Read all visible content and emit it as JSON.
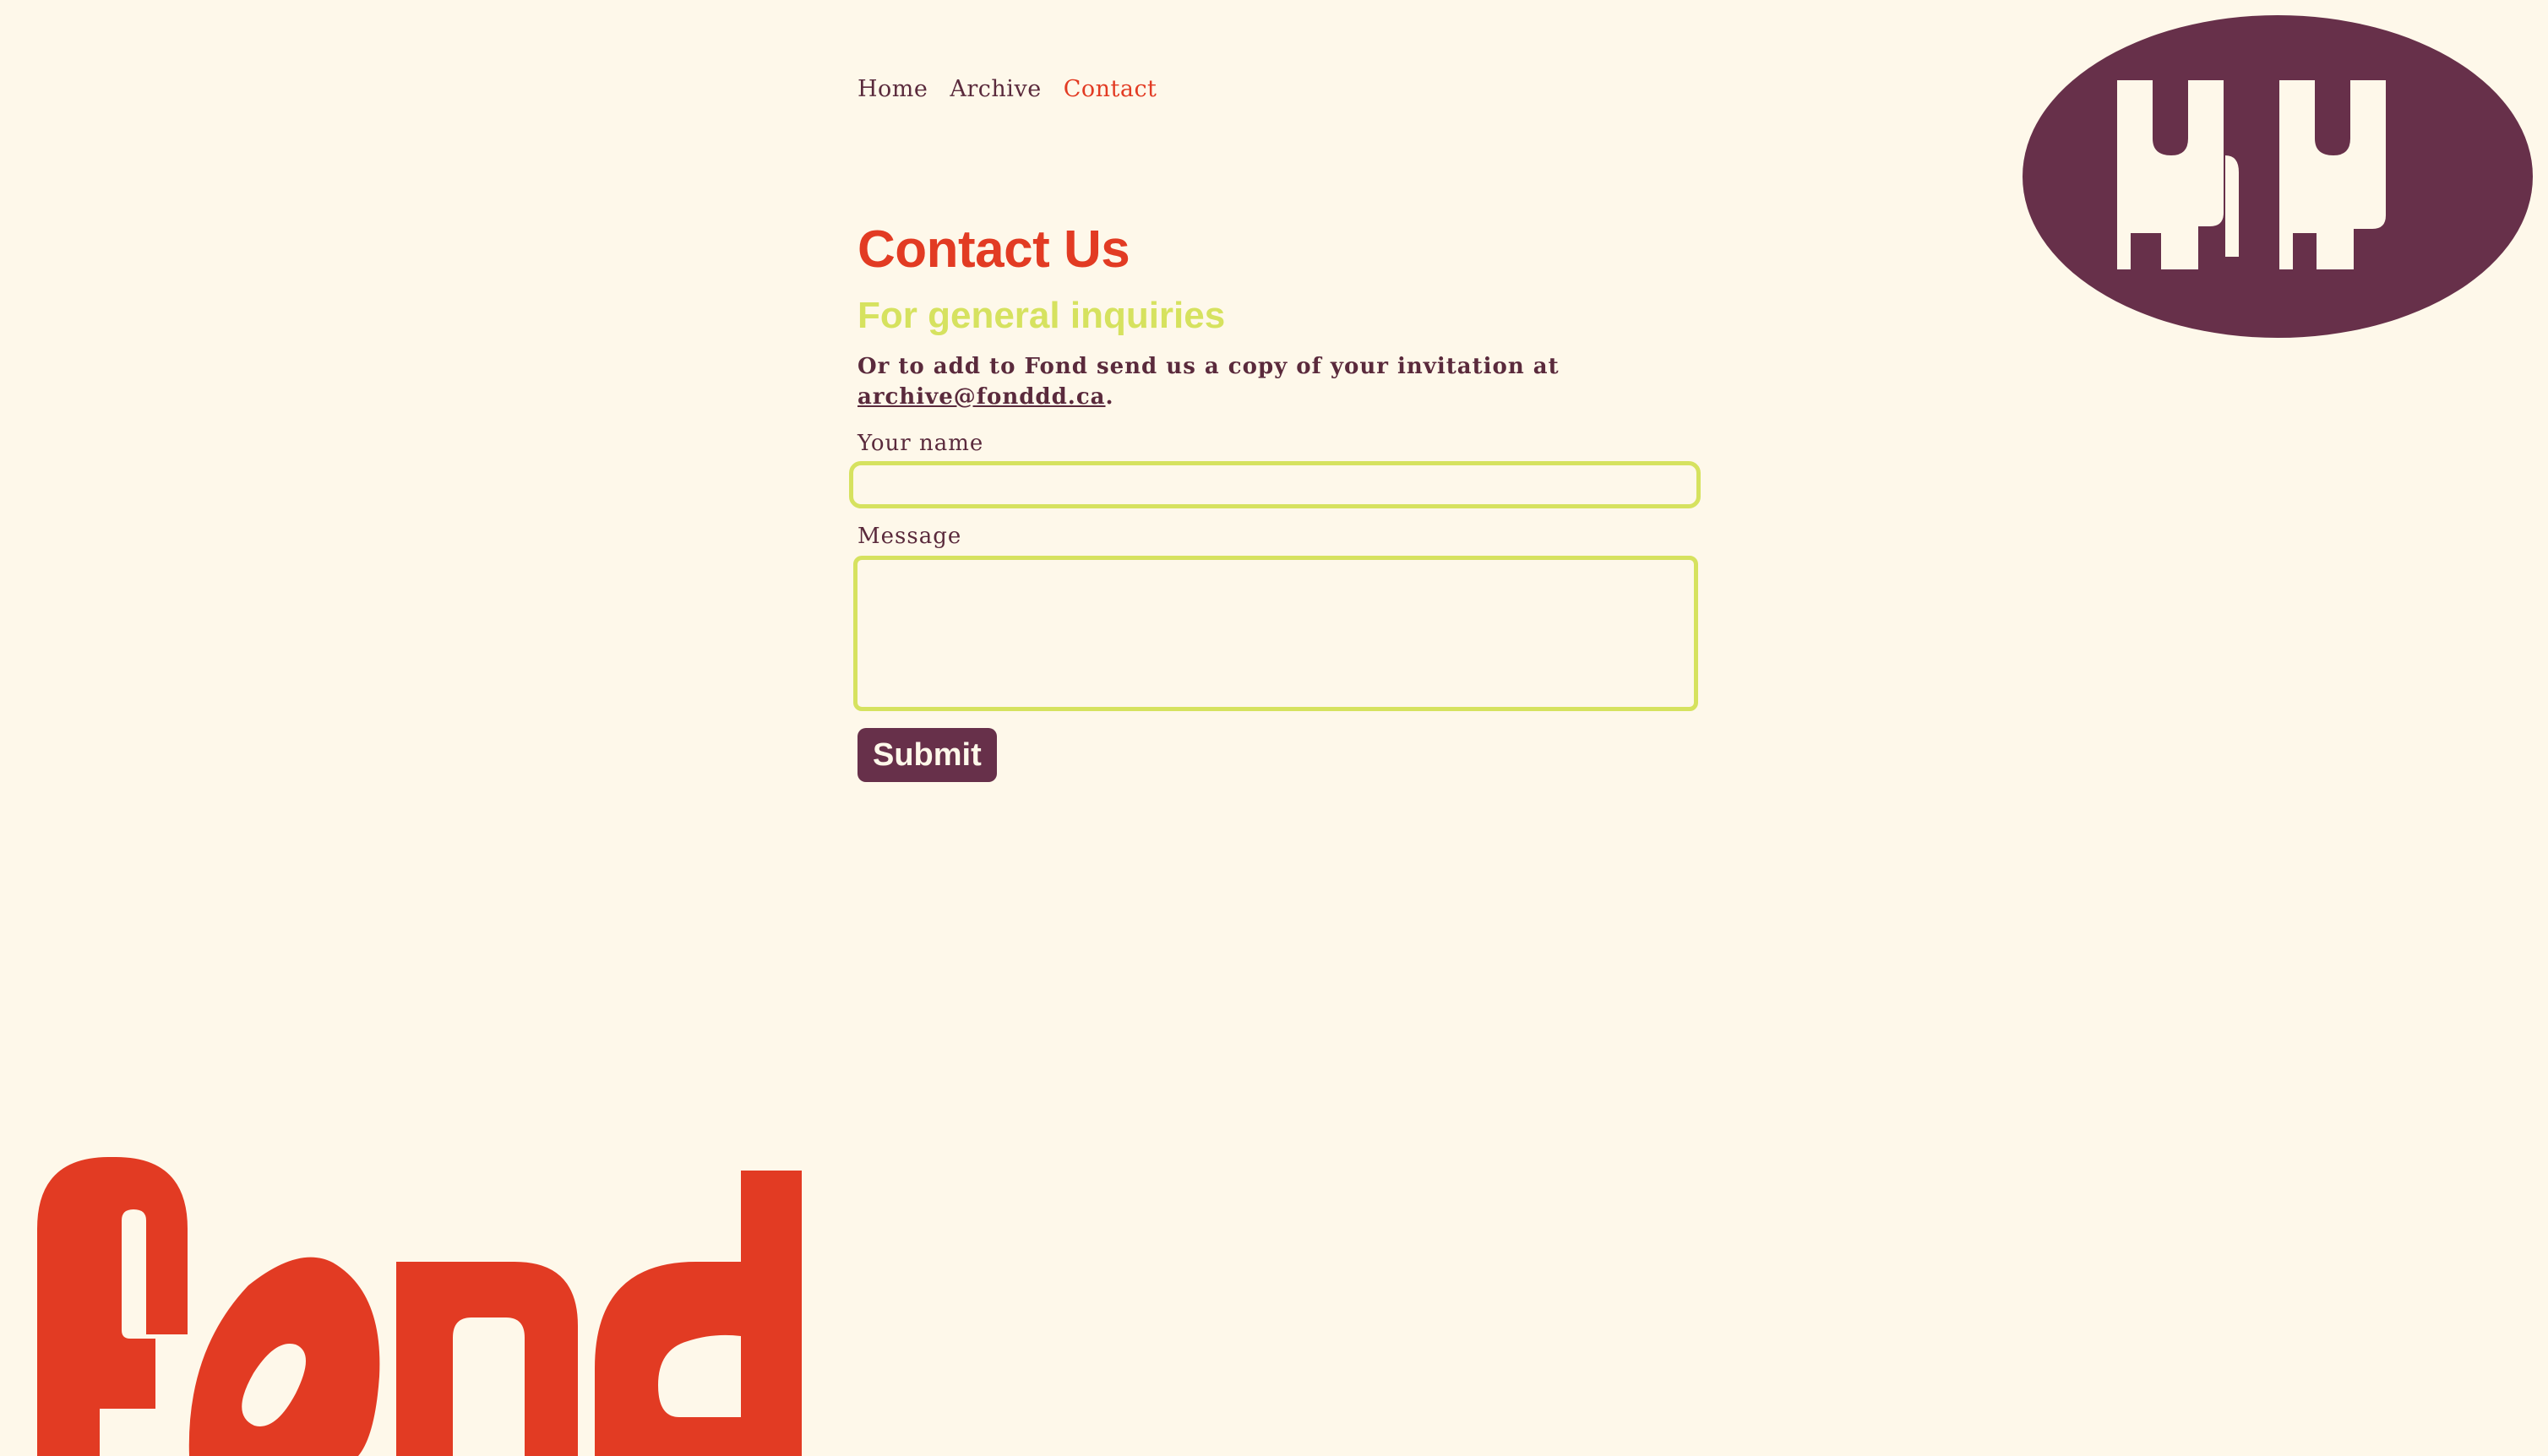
{
  "nav": {
    "items": [
      {
        "label": "Home",
        "active": false
      },
      {
        "label": "Archive",
        "active": false
      },
      {
        "label": "Contact",
        "active": true
      }
    ]
  },
  "main": {
    "title": "Contact Us",
    "subtitle": "For general inquiries",
    "intro_text": "Or to add to Fond send us a copy of your invitation at ",
    "email": "archive@fonddd.ca",
    "intro_end": ".",
    "form": {
      "name_label": "Your name",
      "name_value": "",
      "message_label": "Message",
      "message_value": "",
      "submit_label": "Submit"
    }
  },
  "brand": {
    "wordmark": "fond",
    "emblem_icon": "fond-emblem-icon",
    "wordmark_icon": "fond-wordmark-logo"
  },
  "colors": {
    "background": "#fef8ea",
    "accent_red": "#e23b23",
    "accent_lime": "#d6e25f",
    "plum": "#67304a",
    "text": "#5a2a3c"
  }
}
